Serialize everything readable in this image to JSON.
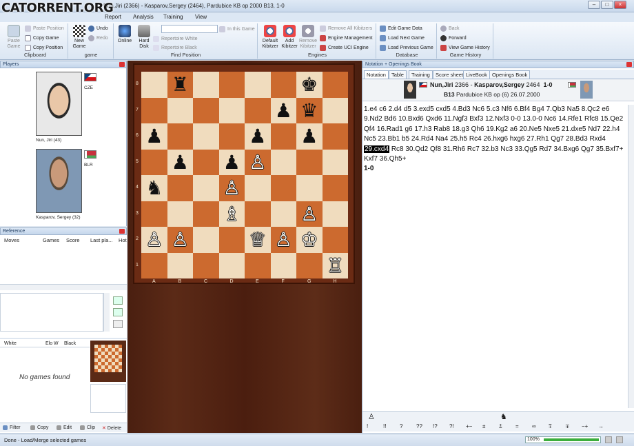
{
  "window": {
    "logo": "CATORRENT.ORG",
    "title": "Nun,Jiri (2366) - Kasparov,Sergey (2464), Pardubice KB op 2000  B13, 1-0",
    "min": "–",
    "max": "□",
    "close": "×"
  },
  "menu": [
    "Report",
    "Analysis",
    "Training",
    "View"
  ],
  "ribbon": {
    "clipboard": {
      "label": "Clipboard",
      "paste_game": "Paste Game",
      "paste_position": "Paste Position",
      "copy_game": "Copy Game",
      "copy_position": "Copy Position"
    },
    "game": {
      "label": "game",
      "new_game": "New Game",
      "undo": "Undo",
      "redo": "Redo"
    },
    "findpos": {
      "label": "Find Position",
      "online": "Online",
      "hard_disk": "Hard Disk",
      "in_this_game": "In this Game",
      "repertoire_white": "Repertoire White",
      "repertoire_black": "Repertoire Black"
    },
    "engines": {
      "label": "Engines",
      "default_kibitzer": "Default Kibitzer",
      "add_kibitzer": "Add Kibitzer",
      "remove_kibitzer": "Remove Kibitzer",
      "remove_all": "Remove All Kibitzers",
      "engine_mgmt": "Engine Management",
      "create_uci": "Create UCI Engine"
    },
    "database": {
      "label": "Database",
      "edit_game_data": "Edit Game Data",
      "load_next": "Load Next Game",
      "load_prev": "Load Previous Game"
    },
    "history": {
      "label": "Game History",
      "back": "Back",
      "forward": "Forward",
      "view_history": "View Game History"
    }
  },
  "players": {
    "title": "Players",
    "white": {
      "name": "Nun, Jiri",
      "elo": "(43)",
      "country": "CZE"
    },
    "black": {
      "name": "Kasparov, Sergey",
      "elo": "(32)",
      "country": "BLR"
    }
  },
  "reference": {
    "title": "Reference",
    "cols": [
      "Moves",
      "Games",
      "Score",
      "Last pla...",
      "Hot"
    ]
  },
  "games": {
    "cols": [
      "White",
      "Elo W",
      "Black"
    ],
    "empty": "No games found",
    "toolbar": [
      "Filter",
      "Copy",
      "Edit",
      "Clip",
      "Delete"
    ]
  },
  "board": {
    "files": [
      "A",
      "B",
      "C",
      "D",
      "E",
      "F",
      "G",
      "H"
    ],
    "ranks": [
      "8",
      "7",
      "6",
      "5",
      "4",
      "3",
      "2",
      "1"
    ],
    "pieces": [
      {
        "sq": "b8",
        "p": "♜",
        "c": "b"
      },
      {
        "sq": "g8",
        "p": "♚",
        "c": "b"
      },
      {
        "sq": "f7",
        "p": "♟",
        "c": "b"
      },
      {
        "sq": "g7",
        "p": "♛",
        "c": "b"
      },
      {
        "sq": "a6",
        "p": "♟",
        "c": "b"
      },
      {
        "sq": "e6",
        "p": "♟",
        "c": "b"
      },
      {
        "sq": "g6",
        "p": "♟",
        "c": "b"
      },
      {
        "sq": "b5",
        "p": "♟",
        "c": "b"
      },
      {
        "sq": "d5",
        "p": "♟",
        "c": "b"
      },
      {
        "sq": "e5",
        "p": "♙",
        "c": "w"
      },
      {
        "sq": "a4",
        "p": "♞",
        "c": "b"
      },
      {
        "sq": "d4",
        "p": "♙",
        "c": "w"
      },
      {
        "sq": "d3",
        "p": "♗",
        "c": "w"
      },
      {
        "sq": "g3",
        "p": "♙",
        "c": "w"
      },
      {
        "sq": "a2",
        "p": "♙",
        "c": "w"
      },
      {
        "sq": "b2",
        "p": "♙",
        "c": "w"
      },
      {
        "sq": "e2",
        "p": "♕",
        "c": "w"
      },
      {
        "sq": "f2",
        "p": "♙",
        "c": "w"
      },
      {
        "sq": "g2",
        "p": "♔",
        "c": "w"
      },
      {
        "sq": "h1",
        "p": "♖",
        "c": "w"
      }
    ]
  },
  "notation": {
    "title": "Notation + Openings Book",
    "tabs": [
      "Notation",
      "Table",
      "Training",
      "Score sheet",
      "LiveBook",
      "Openings Book"
    ],
    "white": "Nun,Jiri",
    "white_elo": "2366",
    "black": "Kasparov,Sergey",
    "black_elo": "2464",
    "result": "1-0",
    "eco": "B13",
    "event": "Pardubice KB op (6) 26.07.2000",
    "moves_before": "1.e4 c6 2.d4 d5 3.exd5 cxd5 4.Bd3 Nc6 5.c3 Nf6 6.Bf4 Bg4 7.Qb3 Na5 8.Qc2 e6 9.Nd2 Bd6 10.Bxd6 Qxd6 11.Ngf3 Bxf3 12.Nxf3 0-0 13.0-0 Nc6 14.Rfe1 Rfc8 15.Qe2 Qf4 16.Rad1 g6 17.h3 Rab8 18.g3 Qh6 19.Kg2 a6 20.Ne5 Nxe5 21.dxe5 Nd7 22.h4 Nc5 23.Bb1 b5 24.Rd4 Na4 25.h5 Rc4 26.hxg6 hxg6 27.Rh1 Qg7 28.Bd3 Rxd4",
    "current_move": "29.cxd4",
    "moves_after": "Rc8 30.Qd2 Qf8 31.Rh6 Rc7 32.b3 Nc3 33.Qg5 Rd7 34.Bxg6 Qg7 35.Bxf7+ Kxf7 36.Qh5+",
    "final_result": "1-0",
    "annot_symbols": [
      "!",
      "!!",
      "?",
      "??",
      "!?",
      "?!",
      "+−",
      "±",
      "⩲",
      "=",
      "∞",
      "⩱",
      "∓",
      "−+",
      "→"
    ]
  },
  "status": {
    "text": "Done - Load/Merge selected games",
    "zoom": "100%",
    "progress": 1.0
  }
}
